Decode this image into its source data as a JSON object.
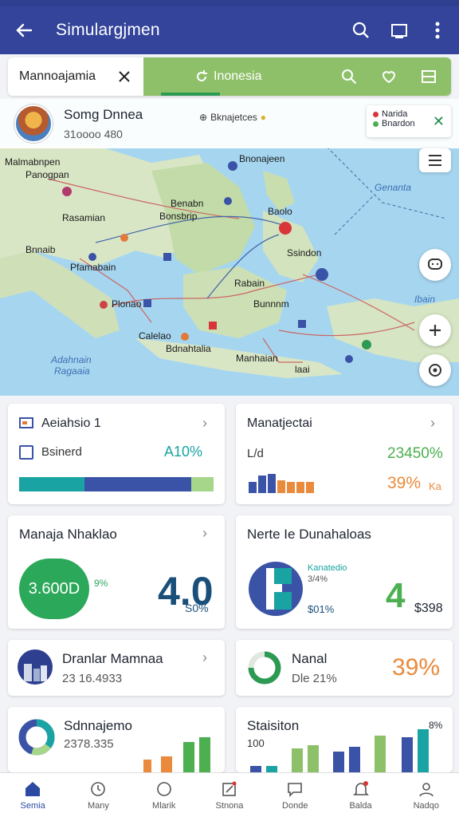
{
  "app": {
    "title": "Simulargjmen",
    "colors": {
      "primary": "#33449a",
      "accent_green": "#8ec06a",
      "blue": "#3b53a6",
      "teal": "#1aa3a3",
      "orange": "#e98a3c",
      "green": "#4caf50"
    }
  },
  "tabs": {
    "left_label": "Mannoajamia",
    "right_label": "Inonesia"
  },
  "location": {
    "name": "Somg Dnnea",
    "sub": "31oooo 480",
    "tag": "Bknajetces",
    "card_line1": "Narida",
    "card_line2": "Bnardon"
  },
  "map_labels": {
    "l1": "Malmabnpen",
    "l2": "Panogpan",
    "l3": "Bnonajeen",
    "l4": "Genanta",
    "l5": "Benabn",
    "l6": "Bonsbrip",
    "l7": "Rasamian",
    "l8": "Baolo",
    "l9": "Bnnaib",
    "l10": "Ssindon",
    "l11": "Pfamabain",
    "l12": "Rabain",
    "l13": "Plonao",
    "l14": "Bunnnm",
    "l15": "Ibain",
    "l16": "Calelao",
    "l17": "Bdnahtalia",
    "l18": "Manhaian",
    "l19": "Adahnain",
    "l20": "Ragaaia",
    "l21": "laai"
  },
  "cards": {
    "c1": {
      "title": "Aeiahsio 1",
      "row_label": "Bsinerd",
      "value": "A10%"
    },
    "c2": {
      "title": "Manatjectai",
      "row_label": "L/d",
      "value": "23450%",
      "value2": "39%",
      "value2_suffix": "Ka"
    },
    "c3": {
      "title": "Manaja Nhaklao",
      "circle_value": "3.600D",
      "circle_pct": "9%",
      "big": "4.0",
      "small": "S0%"
    },
    "c4": {
      "title": "Nerte Ie Dunahaloas",
      "label1": "Kanatedio",
      "label2": "3/4%",
      "label3": "$01%",
      "big": "4",
      "small": "$398"
    },
    "c5": {
      "title": "Dranlar Mamnaa",
      "sub": "23 16.4933"
    },
    "c6": {
      "title": "Nanal",
      "sub": "Dle 21%",
      "value": "39%"
    },
    "c7": {
      "title": "Sdnnajemo",
      "sub": "2378.335"
    },
    "c8": {
      "title": "Staisiton",
      "sub": "100",
      "corner": "8%"
    }
  },
  "bottom_nav": [
    {
      "label": "Semia"
    },
    {
      "label": "Many"
    },
    {
      "label": "Mlarik"
    },
    {
      "label": "Stnona"
    },
    {
      "label": "Donde"
    },
    {
      "label": "Balda"
    },
    {
      "label": "Nadqo"
    }
  ]
}
